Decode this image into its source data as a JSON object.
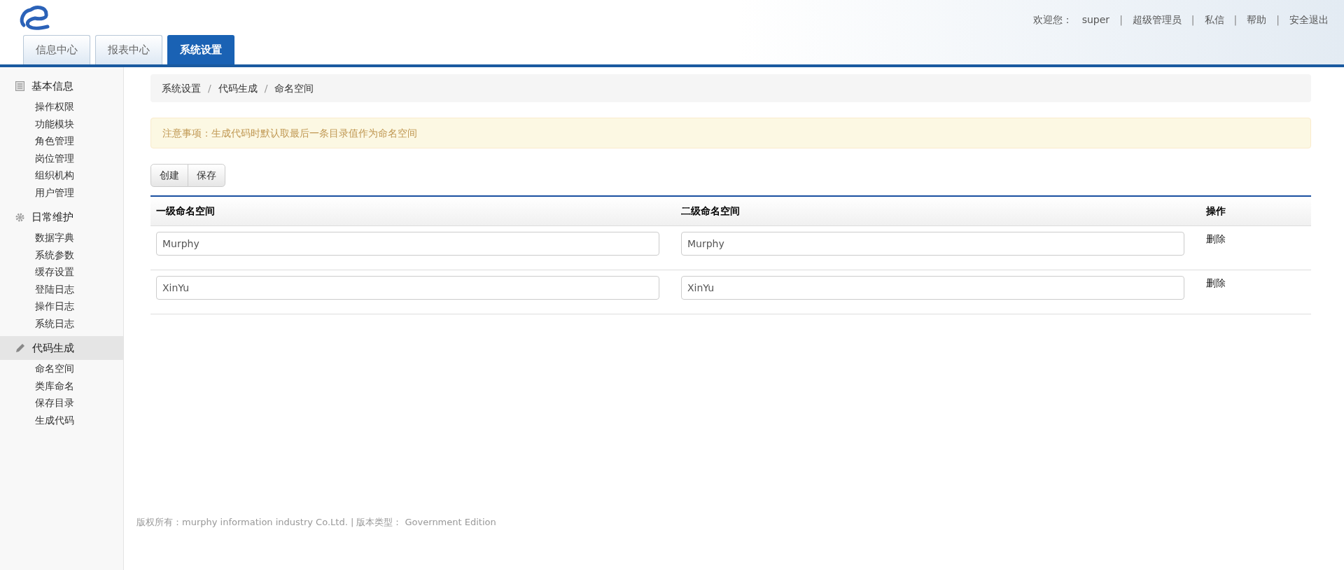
{
  "header": {
    "tabs": [
      {
        "label": "信息中心",
        "selected": false
      },
      {
        "label": "报表中心",
        "selected": false
      },
      {
        "label": "系统设置",
        "selected": true
      }
    ],
    "user_links": [
      {
        "kind": "text",
        "label": "欢迎您："
      },
      {
        "kind": "text",
        "label": "super"
      },
      {
        "kind": "sep",
        "label": "|"
      },
      {
        "kind": "link",
        "label": "超级管理员"
      },
      {
        "kind": "sep",
        "label": "|"
      },
      {
        "kind": "link",
        "label": "私信"
      },
      {
        "kind": "sep",
        "label": "|"
      },
      {
        "kind": "link",
        "label": "帮助"
      },
      {
        "kind": "sep",
        "label": "|"
      },
      {
        "kind": "link",
        "label": "安全退出"
      }
    ]
  },
  "sidebar": {
    "groups": [
      {
        "kind": "list",
        "label": "基本信息",
        "selected": false,
        "children": [
          "操作权限",
          "功能模块",
          "角色管理",
          "岗位管理",
          "组织机构",
          "用户管理"
        ]
      },
      {
        "kind": "gear",
        "label": "日常维护",
        "selected": false,
        "children": [
          "数据字典",
          "系统参数",
          "缓存设置",
          "登陆日志",
          "操作日志",
          "系统日志"
        ]
      },
      {
        "kind": "pencil",
        "label": "代码生成",
        "selected": true,
        "children": [
          "命名空间",
          "类库命名",
          "保存目录",
          "生成代码"
        ]
      }
    ]
  },
  "breadcrumb": {
    "separator": "/",
    "items": [
      "系统设置",
      "代码生成",
      "命名空间"
    ]
  },
  "alert": "注意事项：生成代码时默认取最后一条目录值作为命名空间",
  "buttons": [
    "创建",
    "保存"
  ],
  "table": {
    "columns": [
      "一级命名空间",
      "二级命名空间",
      "操作"
    ],
    "rows": [
      {
        "first": "Murphy",
        "second": "Murphy",
        "action": "删除"
      },
      {
        "first": "XinYu",
        "second": "XinYu",
        "action": "删除"
      }
    ]
  },
  "footer": "版权所有：murphy information industry Co.Ltd. | 版本类型： Government Edition"
}
